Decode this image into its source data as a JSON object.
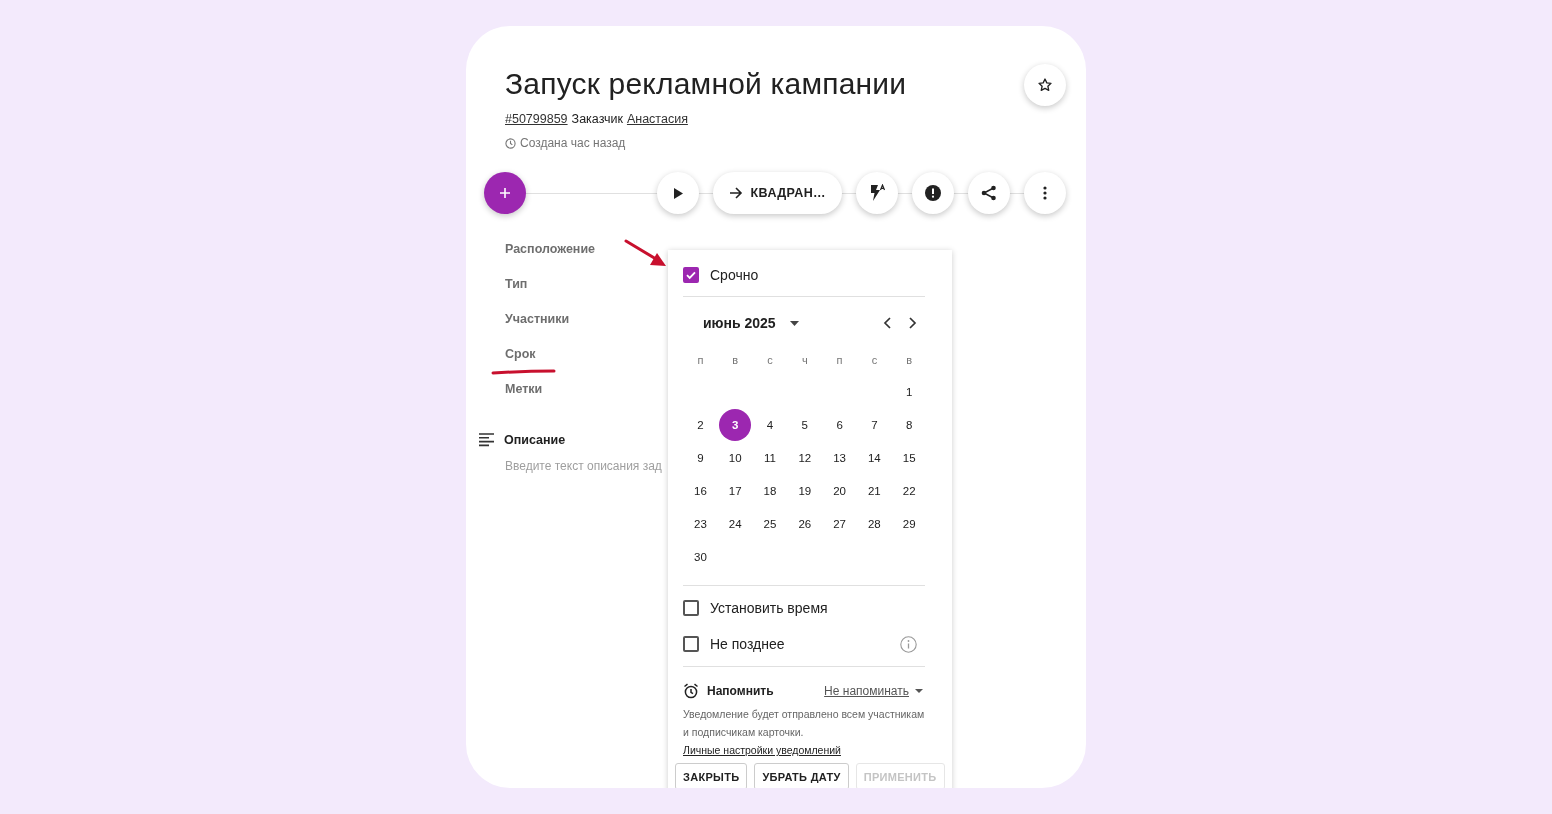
{
  "task": {
    "title": "Запуск рекламной кампании",
    "number": "#50799859",
    "customer_label": "Заказчик",
    "customer": "Анастасия",
    "created": "Создана час назад"
  },
  "toolbar": {
    "status": "КВАДРАН…"
  },
  "fields": [
    "Расположение",
    "Тип",
    "Участники",
    "Срок",
    "Метки"
  ],
  "description": {
    "label": "Описание",
    "placeholder": "Введите текст описания зад"
  },
  "date_popup": {
    "urgent": {
      "label": "Срочно",
      "checked": true
    },
    "month": "июнь 2025",
    "weekdays": [
      "п",
      "в",
      "с",
      "ч",
      "п",
      "с",
      "в"
    ],
    "weeks": [
      [
        {
          "day": "1",
          "selected": false
        }
      ],
      [
        {
          "day": "2",
          "selected": false
        },
        {
          "day": "3",
          "selected": true
        },
        {
          "day": "4",
          "selected": false
        },
        {
          "day": "5",
          "selected": false
        },
        {
          "day": "6",
          "selected": false
        },
        {
          "day": "7",
          "selected": false
        },
        {
          "day": "8",
          "selected": false
        }
      ],
      [
        {
          "day": "9",
          "selected": false
        },
        {
          "day": "10",
          "selected": false
        },
        {
          "day": "11",
          "selected": false
        },
        {
          "day": "12",
          "selected": false
        },
        {
          "day": "13",
          "selected": false
        },
        {
          "day": "14",
          "selected": false
        },
        {
          "day": "15",
          "selected": false
        }
      ],
      [
        {
          "day": "16",
          "selected": false
        },
        {
          "day": "17",
          "selected": false
        },
        {
          "day": "18",
          "selected": false
        },
        {
          "day": "19",
          "selected": false
        },
        {
          "day": "20",
          "selected": false
        },
        {
          "day": "21",
          "selected": false
        },
        {
          "day": "22",
          "selected": false
        }
      ],
      [
        {
          "day": "23",
          "selected": false
        },
        {
          "day": "24",
          "selected": false
        },
        {
          "day": "25",
          "selected": false
        },
        {
          "day": "26",
          "selected": false
        },
        {
          "day": "27",
          "selected": false
        },
        {
          "day": "28",
          "selected": false
        },
        {
          "day": "29",
          "selected": false
        }
      ],
      [
        {
          "day": "30",
          "selected": false
        }
      ]
    ],
    "options": [
      {
        "label": "Установить время",
        "checked": false,
        "info": false
      },
      {
        "label": "Не позднее",
        "checked": false,
        "info": true
      }
    ],
    "reminder": {
      "label": "Напомнить",
      "value": "Не напоминать"
    },
    "notice": "Уведомление будет отправлено всем участникам и подписчикам карточки.",
    "notice_link": "Личные настройки уведомлений",
    "buttons": [
      {
        "label": "ЗАКРЫТЬ",
        "disabled": false
      },
      {
        "label": "УБРАТЬ ДАТУ",
        "disabled": false
      },
      {
        "label": "ПРИМЕНИТЬ",
        "disabled": true
      }
    ]
  }
}
